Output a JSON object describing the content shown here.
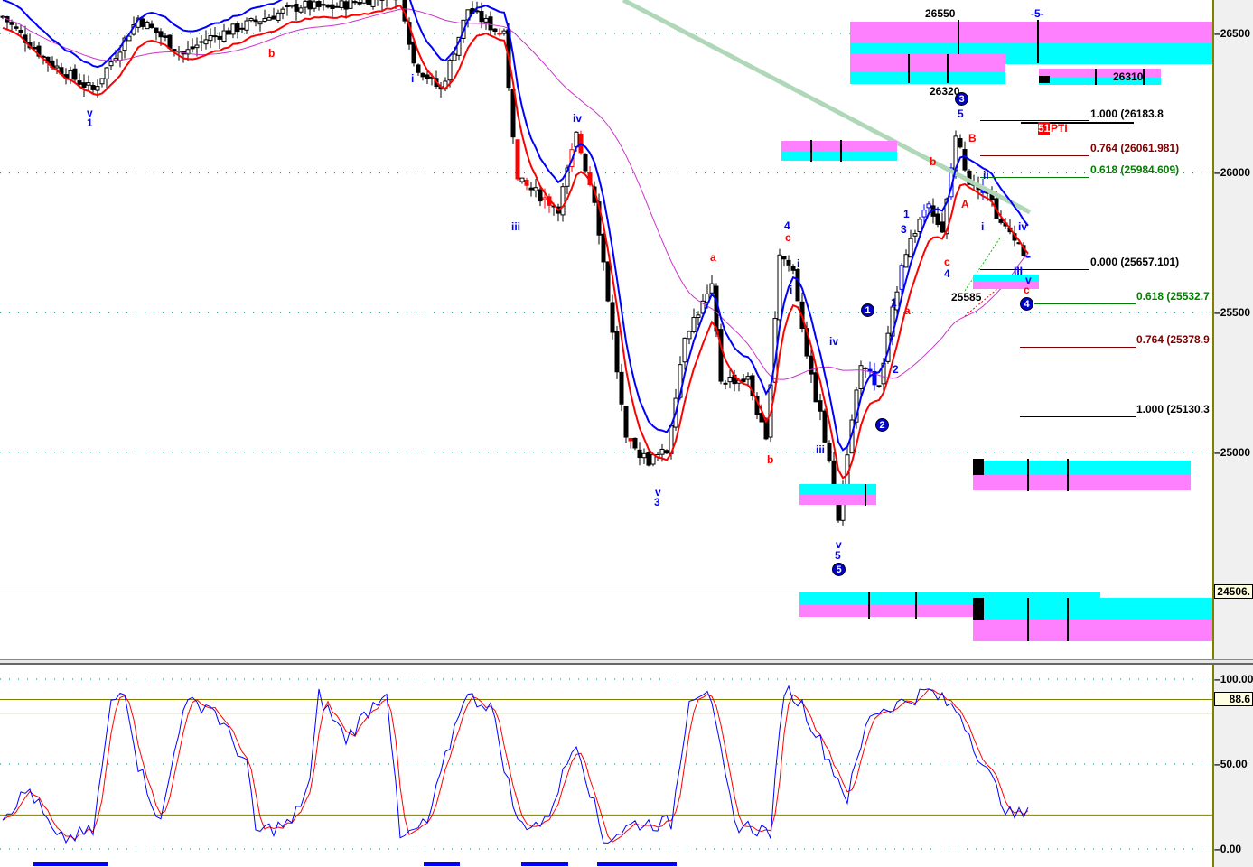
{
  "chart_data": {
    "type": "candlestick",
    "price_axis": {
      "ticks": [
        26500,
        26000,
        25500,
        25000
      ],
      "current_price_label": "24506.",
      "ylim": [
        24330,
        26620
      ]
    },
    "osc_axis": {
      "ticks": [
        "100.00",
        "50.00",
        "0.00"
      ],
      "current_label": "88.6",
      "ylim": [
        0,
        100
      ],
      "levels": [
        88,
        80,
        20
      ]
    },
    "price_path": [
      [
        0,
        26560
      ],
      [
        10,
        26400
      ],
      [
        20,
        26296
      ],
      [
        30,
        26555
      ],
      [
        40,
        26425
      ],
      [
        45,
        26480
      ],
      [
        58,
        26555
      ],
      [
        66,
        26600
      ],
      [
        72,
        26590
      ],
      [
        88,
        26650
      ],
      [
        91,
        26393
      ],
      [
        97,
        26296
      ],
      [
        103,
        26587
      ],
      [
        111,
        26490
      ],
      [
        114,
        25973
      ],
      [
        123,
        25876
      ],
      [
        127,
        26135
      ],
      [
        131,
        25908
      ],
      [
        133,
        25682
      ],
      [
        138,
        25035
      ],
      [
        143,
        24970
      ],
      [
        147,
        25003
      ],
      [
        151,
        25423
      ],
      [
        157,
        25585
      ],
      [
        159,
        25261
      ],
      [
        165,
        25261
      ],
      [
        169,
        25035
      ],
      [
        172,
        25714
      ],
      [
        175,
        25650
      ],
      [
        179,
        25261
      ],
      [
        181,
        25132
      ],
      [
        185,
        24776
      ],
      [
        187,
        25003
      ],
      [
        190,
        25326
      ],
      [
        194,
        25229
      ],
      [
        199,
        25682
      ],
      [
        205,
        25908
      ],
      [
        208,
        25779
      ],
      [
        211,
        26135
      ],
      [
        214,
        25973
      ],
      [
        218,
        25941
      ],
      [
        221,
        25811
      ],
      [
        224,
        25779
      ],
      [
        227,
        25682
      ]
    ],
    "stoch_path": [
      [
        0,
        20
      ],
      [
        6,
        35
      ],
      [
        12,
        5
      ],
      [
        20,
        10
      ],
      [
        24,
        85
      ],
      [
        27,
        95
      ],
      [
        30,
        50
      ],
      [
        35,
        15
      ],
      [
        40,
        85
      ],
      [
        46,
        85
      ],
      [
        54,
        50
      ],
      [
        56,
        10
      ],
      [
        64,
        15
      ],
      [
        68,
        40
      ],
      [
        70,
        90
      ],
      [
        76,
        65
      ],
      [
        85,
        95
      ],
      [
        88,
        5
      ],
      [
        94,
        15
      ],
      [
        102,
        90
      ],
      [
        108,
        85
      ],
      [
        114,
        15
      ],
      [
        120,
        15
      ],
      [
        127,
        65
      ],
      [
        133,
        5
      ],
      [
        140,
        15
      ],
      [
        148,
        15
      ],
      [
        152,
        90
      ],
      [
        156,
        95
      ],
      [
        162,
        15
      ],
      [
        170,
        10
      ],
      [
        173,
        95
      ],
      [
        177,
        85
      ],
      [
        187,
        30
      ],
      [
        192,
        80
      ],
      [
        198,
        85
      ],
      [
        205,
        93
      ],
      [
        212,
        80
      ],
      [
        217,
        50
      ],
      [
        223,
        20
      ],
      [
        228,
        20
      ]
    ],
    "fib_upper": [
      {
        "text": "1.000 (26183.8",
        "color": "#000000"
      },
      {
        "text": "0.764 (26061.981)",
        "color": "#800000"
      },
      {
        "text": "0.618 (25984.609)",
        "color": "#008000"
      },
      {
        "text": "0.000 (25657.101)",
        "color": "#000000"
      }
    ],
    "fib_lower": [
      {
        "text": "0.618 (25532.7",
        "color": "#008000"
      },
      {
        "text": "0.764 (25378.9",
        "color": "#800000"
      },
      {
        "text": "1.000 (25130.3",
        "color": "#000000"
      }
    ],
    "price_labels": [
      "26550",
      "-5-",
      "26320",
      "26310",
      "25585",
      "51",
      "PTI"
    ],
    "wave_labels": [
      "v",
      "1",
      "b",
      "i",
      "iii",
      "iv",
      "3",
      "v",
      "a",
      "b",
      "4",
      "c",
      "i",
      "i",
      "iii",
      "iv",
      "v",
      "5",
      "1",
      "a",
      "2",
      "3",
      "1",
      "c",
      "4",
      "b",
      "5",
      "B",
      "A",
      "ii",
      "i",
      "iv",
      "III",
      "v",
      "c",
      "3",
      "v"
    ],
    "circles": [
      "3",
      "1",
      "2",
      "5",
      "4"
    ],
    "colors": {
      "cyan": "#00ffff",
      "magenta": "#ff80ff",
      "red": "#ff0000",
      "blue": "#0000ff",
      "ma": "#cc33cc",
      "longma": "#b0d8b8"
    }
  }
}
